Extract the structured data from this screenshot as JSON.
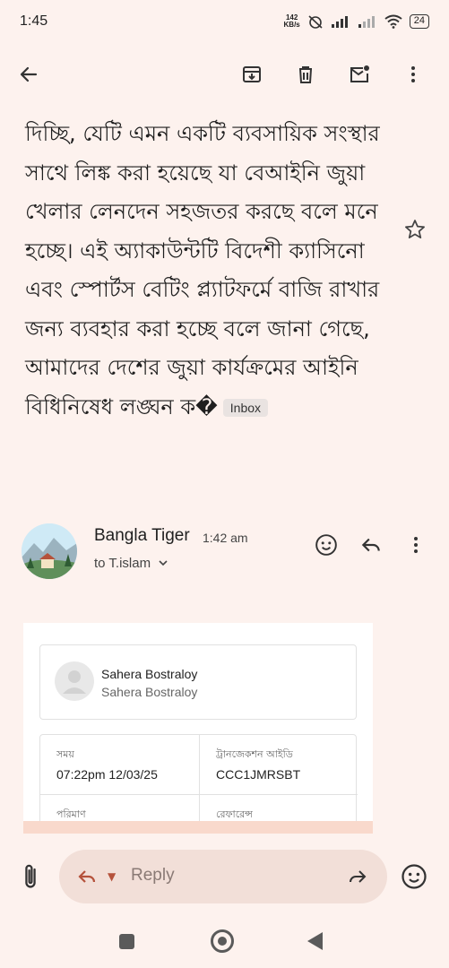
{
  "status": {
    "time": "1:45",
    "net_speed_value": "142",
    "net_speed_unit": "KB/s",
    "battery": "24"
  },
  "toolbar": {
    "back_icon": "arrow-left-icon",
    "archive_icon": "archive-icon",
    "delete_icon": "trash-icon",
    "mark_unread_icon": "mail-unread-icon",
    "more_icon": "more-vert-icon"
  },
  "email": {
    "subject": "দিচ্ছি, যেটি এমন একটি ব্যবসায়িক সংস্থার সাথে লিঙ্ক করা হয়েছে যা বেআইনি জুয়া খেলার লেনদেন সহজতর করছে বলে মনে হচ্ছে। এই অ্যাকাউন্টটি বিদেশী ক্যাসিনো এবং স্পোর্টস বেটিং প্ল্যাটফর্মে বাজি রাখার জন্য ব্যবহার করা হচ্ছে বলে জানা গেছে, আমাদের দেশের জুয়া কার্যক্রমের আইনি বিধিনিষেধ লঙ্ঘন ক�",
    "label_chip": "Inbox",
    "sender_name": "Bangla Tiger",
    "sent_time": "1:42 am",
    "to_line": "to T.islam"
  },
  "embedded_card": {
    "name_primary": "Sahera Bostraloy",
    "name_secondary": "Sahera Bostraloy",
    "fields": [
      {
        "label": "সময়",
        "value": "07:22pm 12/03/25"
      },
      {
        "label": "ট্রানজেকশন আইডি",
        "value": "CCC1JMRSBT"
      },
      {
        "label": "পরিমাণ",
        "value": ""
      },
      {
        "label": "রেফারেন্স",
        "value": ""
      }
    ]
  },
  "reply_bar": {
    "placeholder": "Reply"
  },
  "colors": {
    "background": "#fdf2ee",
    "reply_pill": "#f2dfd8",
    "accent": "#b5523b"
  }
}
